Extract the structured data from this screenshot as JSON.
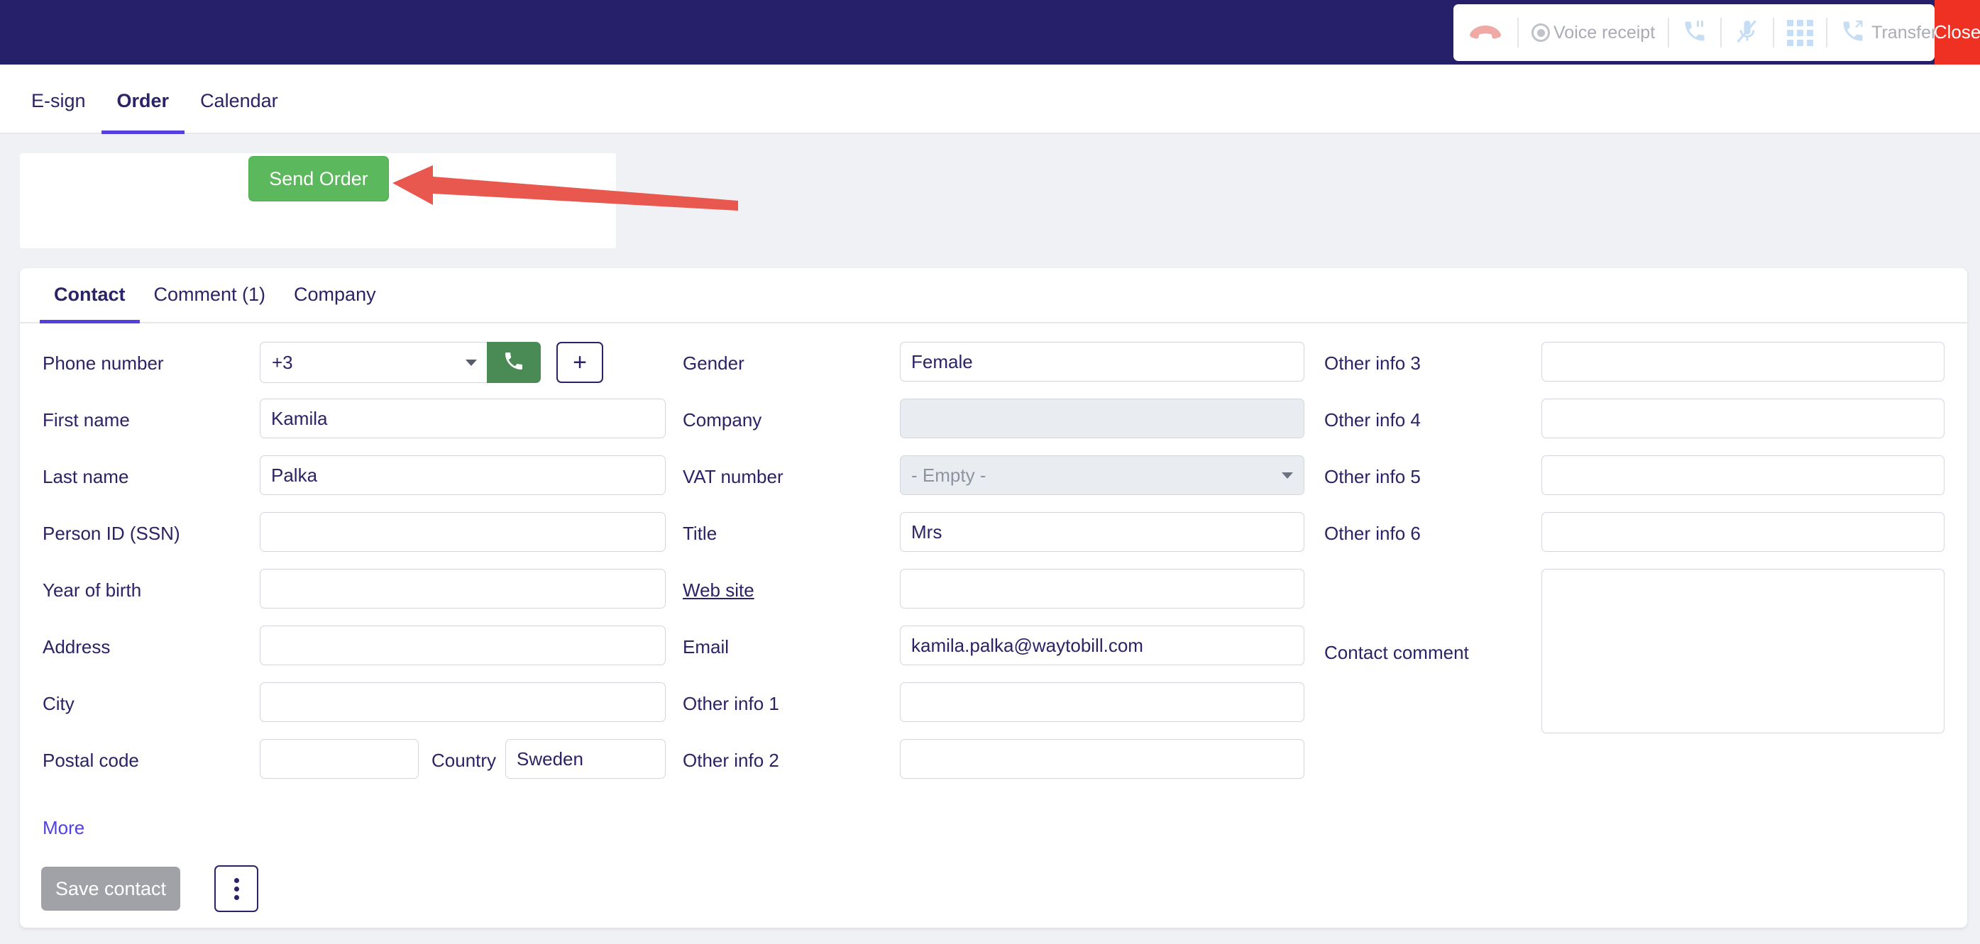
{
  "callbar": {
    "hangup_icon": "phone-hangup-icon",
    "voice_receipt_label": "Voice receipt",
    "hold_icon": "phone-hold-icon",
    "mute_icon": "microphone-muted-icon",
    "dialpad_icon": "dialpad-icon",
    "transfer_icon": "phone-transfer-icon",
    "transfer_label": "Transfer",
    "close_label": "Close",
    "close_color": "#ef3124",
    "bar_color": "#26206b"
  },
  "main_tabs": [
    {
      "label": "E-sign",
      "active": false
    },
    {
      "label": "Order",
      "active": true
    },
    {
      "label": "Calendar",
      "active": false
    }
  ],
  "send_panel": {
    "button_label": "Send Order",
    "button_color": "#5cb85c",
    "annotation_arrow_color": "#e8584f"
  },
  "sub_tabs": [
    {
      "label": "Contact",
      "active": true
    },
    {
      "label": "Comment (1)",
      "active": false
    },
    {
      "label": "Company",
      "active": false
    }
  ],
  "form": {
    "col1": [
      {
        "label": "Phone number",
        "value": "",
        "type": "phone"
      },
      {
        "label": "First name",
        "value": "Kamila",
        "type": "text"
      },
      {
        "label": "Last name",
        "value": "Palka",
        "type": "text"
      },
      {
        "label": "Person ID (SSN)",
        "value": "",
        "type": "text"
      },
      {
        "label": "Year of birth",
        "value": "",
        "type": "text"
      },
      {
        "label": "Address",
        "value": "",
        "type": "text"
      },
      {
        "label": "City",
        "value": "",
        "type": "text"
      },
      {
        "label": "Postal code",
        "value": "",
        "type": "text"
      }
    ],
    "country": {
      "label": "Country",
      "value": "Sweden"
    },
    "col2": [
      {
        "label": "Gender",
        "value": "Female",
        "type": "text"
      },
      {
        "label": "Company",
        "value": "",
        "type": "disabled"
      },
      {
        "label": "VAT number",
        "value": "- Empty -",
        "type": "select"
      },
      {
        "label": "Title",
        "value": "Mrs",
        "type": "text"
      },
      {
        "label": "Web site",
        "value": "",
        "type": "text",
        "link": true
      },
      {
        "label": "Email",
        "value": "kamila.palka@waytobill.com",
        "type": "text"
      },
      {
        "label": "Other info 1",
        "value": "",
        "type": "text"
      },
      {
        "label": "Other info 2",
        "value": "",
        "type": "text"
      }
    ],
    "col3": [
      {
        "label": "Other info 3",
        "value": "",
        "type": "text"
      },
      {
        "label": "Other info 4",
        "value": "",
        "type": "text"
      },
      {
        "label": "Other info 5",
        "value": "",
        "type": "text"
      },
      {
        "label": "Other info 6",
        "value": "",
        "type": "text"
      }
    ],
    "contact_comment": {
      "label": "Contact comment",
      "value": ""
    },
    "phone_prefix": "+3",
    "call_icon": "phone-call-icon",
    "add_icon": "plus-icon"
  },
  "footer": {
    "more_label": "More",
    "save_label": "Save contact",
    "kebab_icon": "more-vertical-icon"
  }
}
